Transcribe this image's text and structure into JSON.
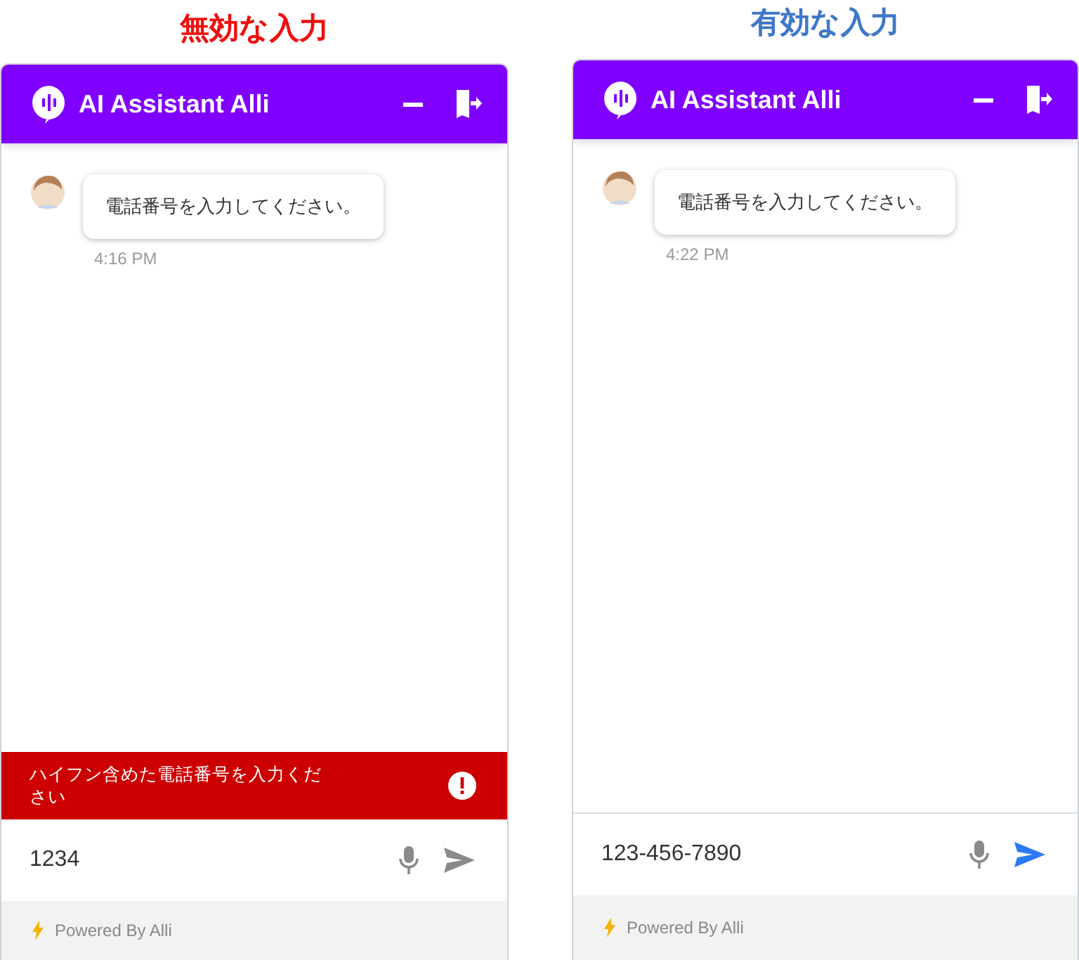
{
  "panels": [
    {
      "kind": "invalid",
      "caption": "無効な入力",
      "window": {
        "title": "AI Assistant Alli"
      },
      "messages": [
        {
          "text": "電話番号を入力してください。",
          "time": "4:16 PM"
        }
      ],
      "error": "ハイフン含めた電話番号を入力ください",
      "input": {
        "value": "1234"
      },
      "send_enabled": false,
      "footer": "Powered By Alli"
    },
    {
      "kind": "valid",
      "caption": "有効な入力",
      "window": {
        "title": "AI Assistant Alli"
      },
      "messages": [
        {
          "text": "電話番号を入力してください。",
          "time": "4:22 PM"
        }
      ],
      "input": {
        "value": "123-456-7890"
      },
      "send_enabled": true,
      "footer": "Powered By Alli"
    }
  ]
}
